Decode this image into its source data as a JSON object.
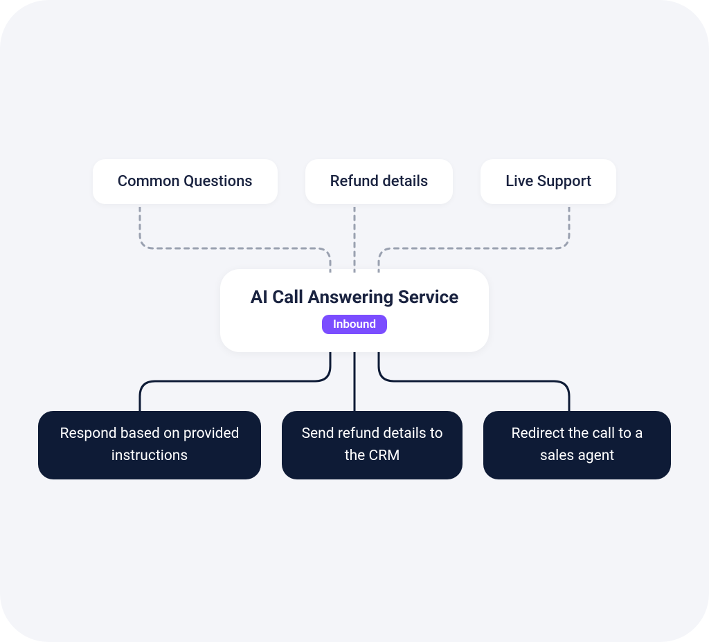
{
  "inputs": [
    "Common Questions",
    "Refund details",
    "Live Support"
  ],
  "center": {
    "title": "AI Call Answering Service",
    "badge": "Inbound"
  },
  "outputs": [
    "Respond based on provided instructions",
    "Send refund details to the CRM",
    "Redirect the call to a sales agent"
  ],
  "colors": {
    "background": "#f4f5f9",
    "card_dark": "#0e1b36",
    "card_light": "#ffffff",
    "text_dark": "#1a2340",
    "badge": "#7b4dff",
    "dashed_line": "#9aa1b0",
    "solid_line": "#0e1b36"
  }
}
